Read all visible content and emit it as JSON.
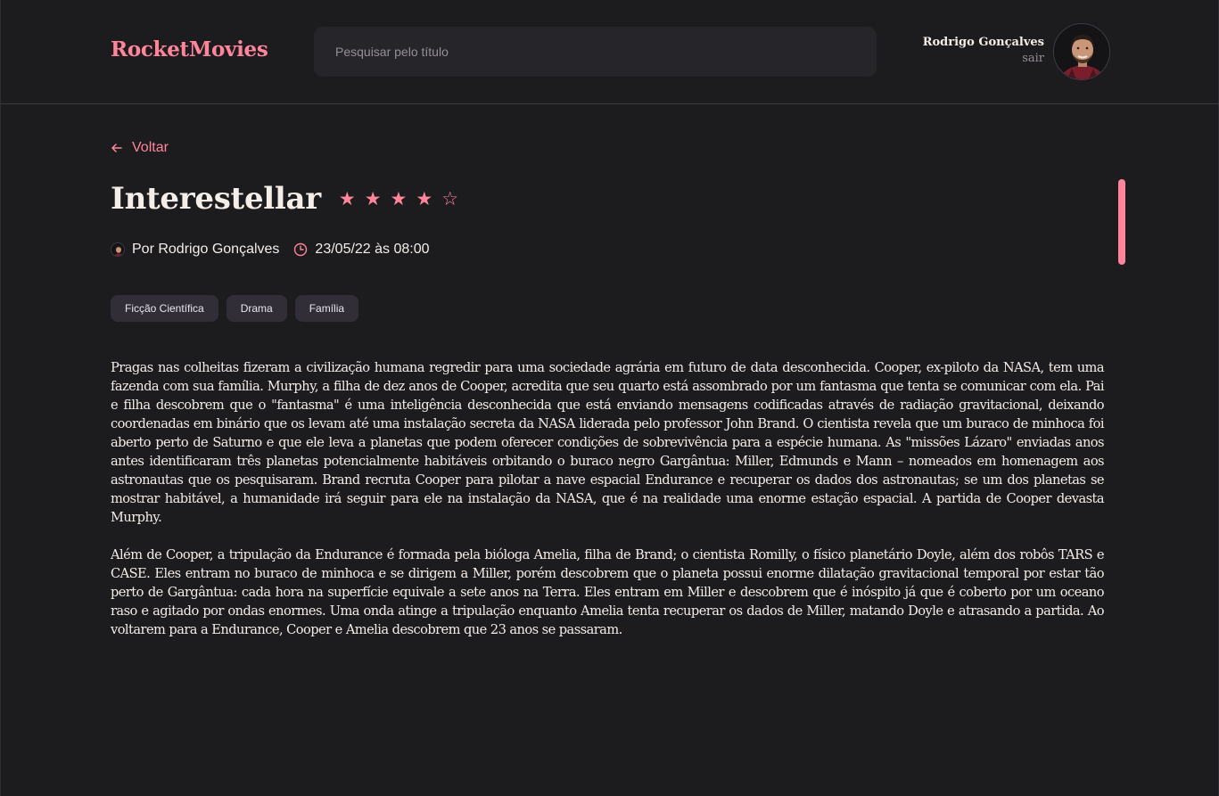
{
  "header": {
    "logo": "RocketMovies",
    "search_placeholder": "Pesquisar pelo título",
    "user_name": "Rodrigo Gonçalves",
    "signout_label": "sair"
  },
  "back_label": "Voltar",
  "movie": {
    "title": "Interestellar",
    "rating": 4,
    "max_rating": 5,
    "author": "Por Rodrigo Gonçalves",
    "datetime": "23/05/22 às 08:00",
    "tags": [
      "Ficção Científica",
      "Drama",
      "Família"
    ],
    "paragraphs": [
      "Pragas nas colheitas fizeram a civilização humana regredir para uma sociedade agrária em futuro de data desconhecida. Cooper, ex-piloto da NASA, tem uma fazenda com sua família. Murphy, a filha de dez anos de Cooper, acredita que seu quarto está assombrado por um fantasma que tenta se comunicar com ela. Pai e filha descobrem que o \"fantasma\" é uma inteligência desconhecida que está enviando mensagens codificadas através de radiação gravitacional, deixando coordenadas em binário que os levam até uma instalação secreta da NASA liderada pelo professor John Brand. O cientista revela que um buraco de minhoca foi aberto perto de Saturno e que ele leva a planetas que podem oferecer condições de sobrevivência para a espécie humana. As \"missões Lázaro\" enviadas anos antes identificaram três planetas potencialmente habitáveis orbitando o buraco negro Gargântua: Miller, Edmunds e Mann – nomeados em homenagem aos astronautas que os pesquisaram. Brand recruta Cooper para pilotar a nave espacial Endurance e recuperar os dados dos astronautas; se um dos planetas se mostrar habitável, a humanidade irá seguir para ele na instalação da NASA, que é na realidade uma enorme estação espacial. A partida de Cooper devasta Murphy.",
      "Além de Cooper, a tripulação da Endurance é formada pela bióloga Amelia, filha de Brand; o cientista Romilly, o físico planetário Doyle, além dos robôs TARS e CASE. Eles entram no buraco de minhoca e se dirigem a Miller, porém descobrem que o planeta possui enorme dilatação gravitacional temporal por estar tão perto de Gargântua: cada hora na superfície equivale a sete anos na Terra. Eles entram em Miller e descobrem que é inóspito já que é coberto por um oceano raso e agitado por ondas enormes. Uma onda atinge a tripulação enquanto Amelia tenta recuperar os dados de Miller, matando Doyle e atrasando a partida. Ao voltarem para a Endurance, Cooper e Amelia descobrem que 23 anos se passaram."
    ]
  },
  "colors": {
    "accent": "#ff859b",
    "background": "#1c1b1e",
    "text": "#f4ede8",
    "tag_bg": "#312e38"
  }
}
